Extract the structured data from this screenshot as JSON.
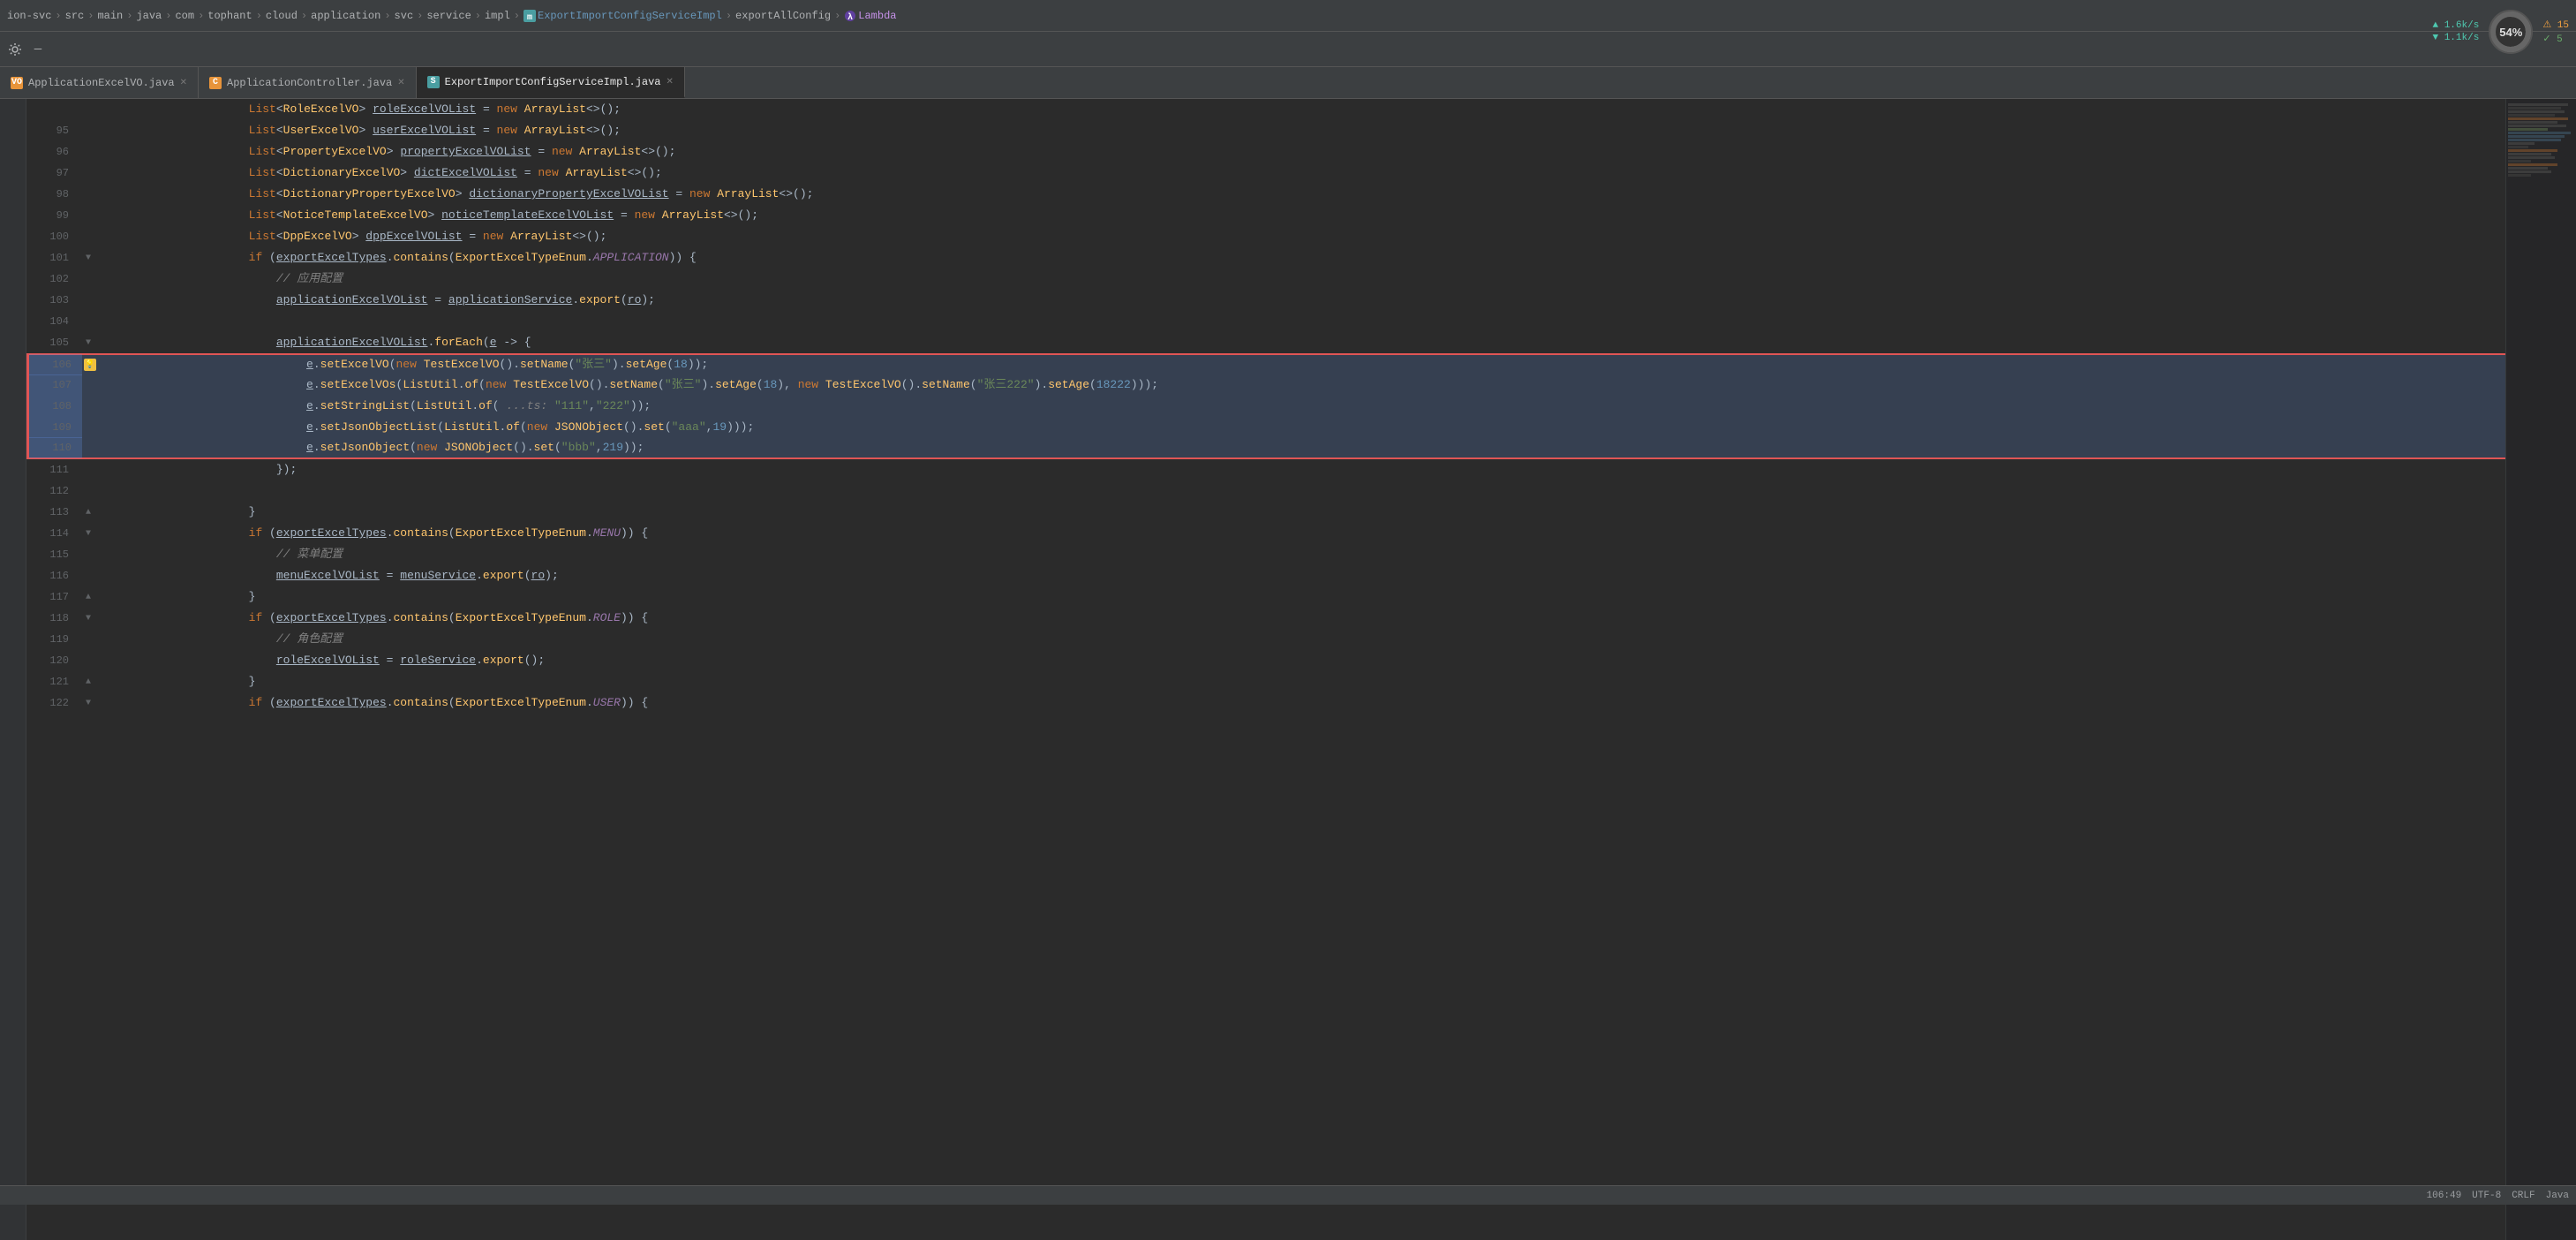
{
  "breadcrumb": {
    "items": [
      {
        "label": "ion-svc",
        "type": "project"
      },
      {
        "label": "src",
        "type": "folder"
      },
      {
        "label": "main",
        "type": "folder"
      },
      {
        "label": "java",
        "type": "folder"
      },
      {
        "label": "com",
        "type": "folder"
      },
      {
        "label": "tophant",
        "type": "folder"
      },
      {
        "label": "cloud",
        "type": "folder"
      },
      {
        "label": "application",
        "type": "folder"
      },
      {
        "label": "svc",
        "type": "folder"
      },
      {
        "label": "service",
        "type": "folder"
      },
      {
        "label": "impl",
        "type": "folder"
      },
      {
        "label": "ExportImportConfigServiceImpl",
        "type": "class"
      },
      {
        "label": "exportAllConfig",
        "type": "method"
      },
      {
        "label": "Lambda",
        "type": "lambda"
      }
    ],
    "separator": "›"
  },
  "tabs": [
    {
      "label": "ApplicationExcelVO.java",
      "icon": "orange",
      "active": false,
      "closable": true
    },
    {
      "label": "ApplicationController.java",
      "icon": "orange",
      "active": false,
      "closable": true
    },
    {
      "label": "ExportImportConfigServiceImpl.java",
      "icon": "teal",
      "active": true,
      "closable": true
    }
  ],
  "toolbar": {
    "settings_label": "⚙",
    "minimize_label": "—"
  },
  "code": {
    "lines": [
      {
        "num": 95,
        "indent": 3,
        "code": "List<UserExcelVO> userExcelVOList = new ArrayList<>();",
        "selected": false,
        "gutter": ""
      },
      {
        "num": 96,
        "indent": 3,
        "code": "List<PropertyExcelVO> propertyExcelVOList = new ArrayList<>();",
        "selected": false,
        "gutter": ""
      },
      {
        "num": 97,
        "indent": 3,
        "code": "List<DictionaryExcelVO> dictExcelVOList = new ArrayList<>();",
        "selected": false,
        "gutter": ""
      },
      {
        "num": 98,
        "indent": 3,
        "code": "List<DictionaryPropertyExcelVO> dictionaryPropertyExcelVOList = new ArrayList<>();",
        "selected": false,
        "gutter": ""
      },
      {
        "num": 99,
        "indent": 3,
        "code": "List<NoticeTemplateExcelVO> noticeTemplateExcelVOList = new ArrayList<>();",
        "selected": false,
        "gutter": ""
      },
      {
        "num": 100,
        "indent": 3,
        "code": "List<DppExcelVO> dppExcelVOList = new ArrayList<>();",
        "selected": false,
        "gutter": ""
      },
      {
        "num": 101,
        "indent": 3,
        "code": "if (exportExcelTypes.contains(ExportExcelTypeEnum.APPLICATION)) {",
        "selected": false,
        "gutter": "collapse"
      },
      {
        "num": 102,
        "indent": 4,
        "code": "// 应用配置",
        "selected": false,
        "gutter": ""
      },
      {
        "num": 103,
        "indent": 4,
        "code": "applicationExcelVOList = applicationService.export(ro);",
        "selected": false,
        "gutter": ""
      },
      {
        "num": 104,
        "indent": 4,
        "code": "",
        "selected": false,
        "gutter": ""
      },
      {
        "num": 105,
        "indent": 4,
        "code": "applicationExcelVOList.forEach(e -> {",
        "selected": false,
        "gutter": "collapse"
      },
      {
        "num": 106,
        "indent": 5,
        "code": "e.setExcelVO(new TestExcelVO().setName(\"张三\").setAge(18));",
        "selected": true,
        "gutter": "bulb"
      },
      {
        "num": 107,
        "indent": 5,
        "code": "e.setExcelVOs(ListUtil.of(new TestExcelVO().setName(\"张三\").setAge(18), new TestExcelVO().setName(\"张三222\").setAge(18222)));",
        "selected": true,
        "gutter": ""
      },
      {
        "num": 108,
        "indent": 5,
        "code": "e.setStringList(ListUtil.of( ...ts: \"111\",\"222\"));",
        "selected": true,
        "gutter": ""
      },
      {
        "num": 109,
        "indent": 5,
        "code": "e.setJsonObjectList(ListUtil.of(new JSONObject().set(\"aaa\",19)));",
        "selected": true,
        "gutter": ""
      },
      {
        "num": 110,
        "indent": 5,
        "code": "e.setJsonObject(new JSONObject().set(\"bbb\",219));",
        "selected": true,
        "gutter": ""
      },
      {
        "num": 111,
        "indent": 4,
        "code": "});",
        "selected": false,
        "gutter": ""
      },
      {
        "num": 112,
        "indent": 4,
        "code": "",
        "selected": false,
        "gutter": ""
      },
      {
        "num": 113,
        "indent": 3,
        "code": "}",
        "selected": false,
        "gutter": ""
      },
      {
        "num": 114,
        "indent": 3,
        "code": "if (exportExcelTypes.contains(ExportExcelTypeEnum.MENU)) {",
        "selected": false,
        "gutter": "collapse"
      },
      {
        "num": 115,
        "indent": 4,
        "code": "// 菜单配置",
        "selected": false,
        "gutter": ""
      },
      {
        "num": 116,
        "indent": 4,
        "code": "menuExcelVOList = menuService.export(ro);",
        "selected": false,
        "gutter": ""
      },
      {
        "num": 117,
        "indent": 3,
        "code": "}",
        "selected": false,
        "gutter": ""
      },
      {
        "num": 118,
        "indent": 3,
        "code": "if (exportExcelTypes.contains(ExportExcelTypeEnum.ROLE)) {",
        "selected": false,
        "gutter": "collapse"
      },
      {
        "num": 119,
        "indent": 4,
        "code": "// 角色配置",
        "selected": false,
        "gutter": ""
      },
      {
        "num": 120,
        "indent": 4,
        "code": "roleExcelVOList = roleService.export();",
        "selected": false,
        "gutter": ""
      },
      {
        "num": 121,
        "indent": 3,
        "code": "}",
        "selected": false,
        "gutter": ""
      },
      {
        "num": 122,
        "indent": 3,
        "code": "if (exportExcelTypes.contains(ExportExcelTypeEnum.USER)) {",
        "selected": false,
        "gutter": "collapse"
      }
    ]
  },
  "perf": {
    "cpu_label": "54%",
    "net_up": "1.6k/s",
    "net_down": "1.1k/s",
    "warn_count": "15",
    "ok_count": "5"
  },
  "status": {
    "encoding": "UTF-8",
    "line_sep": "CRLF",
    "lang": "Java",
    "position": "106:49"
  }
}
